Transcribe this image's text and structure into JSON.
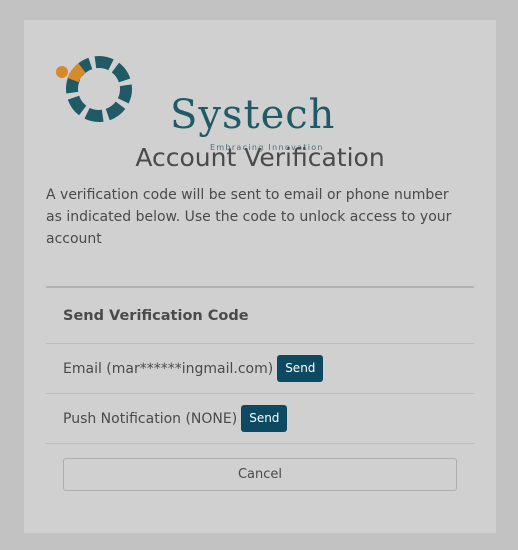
{
  "brand": {
    "name": "Systech",
    "tagline": "Embracing Innovation",
    "colors": {
      "teal": "#1f5a66",
      "orange": "#d68a2a"
    }
  },
  "page": {
    "title": "Account Verification",
    "intro": "A verification code will be sent to email or phone number as indicated below. Use the code to unlock access to your account"
  },
  "options": {
    "header": "Send Verification Code",
    "items": [
      {
        "label": "Email (mar******ingmail.com)",
        "button": "Send"
      },
      {
        "label": "Push Notification (NONE)",
        "button": "Send"
      }
    ]
  },
  "actions": {
    "cancel": "Cancel"
  },
  "colors": {
    "send_button": "#0d4a62",
    "background": "#c2c2c2",
    "card": "#d0d0d0"
  }
}
